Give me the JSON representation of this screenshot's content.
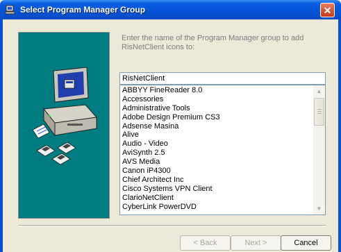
{
  "window": {
    "title": "Select Program Manager Group",
    "close_glyph": "✕"
  },
  "instructions": "Enter the name of the Program Manager group to add RisNetClient icons to:",
  "group_input": {
    "value": "RisNetClient"
  },
  "groups": [
    "ABBYY FineReader 8.0",
    "Accessories",
    "Administrative Tools",
    "Adobe Design Premium CS3",
    "Adsense Masina",
    "Alive",
    "Audio - Video",
    "AviSynth 2.5",
    "AVS Media",
    "Canon iP4300",
    "Chief Architect Inc",
    "Cisco Systems VPN Client",
    "ClarioNetClient",
    "CyberLink PowerDVD"
  ],
  "buttons": {
    "back": "< Back",
    "next": "Next >",
    "cancel": "Cancel"
  },
  "colors": {
    "titlebar": "#0553d4",
    "art_background": "#007c80",
    "dialog_background": "#ece9d8"
  }
}
